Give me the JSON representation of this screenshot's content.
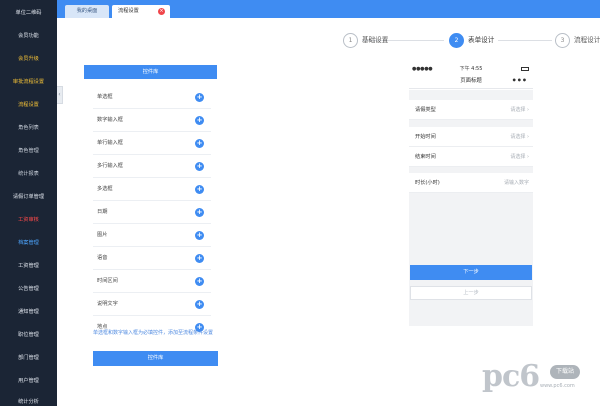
{
  "sidebar": {
    "items": [
      {
        "label": "单位二维码",
        "style": "normal"
      },
      {
        "label": "会员功能",
        "style": "normal"
      },
      {
        "label": "会员升级",
        "style": "yellow"
      },
      {
        "label": "审批流程设置",
        "style": "yellow"
      },
      {
        "label": "流程设置",
        "style": "yellow"
      },
      {
        "label": "角色列表",
        "style": "sub"
      },
      {
        "label": "角色管理",
        "style": "sub"
      },
      {
        "label": "统计报表",
        "style": "sub"
      },
      {
        "label": "请假订单管理",
        "style": "normal"
      },
      {
        "label": "工资审核",
        "style": "red"
      },
      {
        "label": "档案管理",
        "style": "blue"
      },
      {
        "label": "工资管理",
        "style": "normal"
      },
      {
        "label": "公告管理",
        "style": "normal"
      },
      {
        "label": "通知管理",
        "style": "normal"
      },
      {
        "label": "职位管理",
        "style": "normal"
      },
      {
        "label": "部门管理",
        "style": "normal"
      },
      {
        "label": "用户管理",
        "style": "normal"
      },
      {
        "label": "统计分析",
        "style": "normal"
      }
    ],
    "collapse_glyph": "‹"
  },
  "tabs": {
    "home": "我的桌面",
    "active": "流程设置",
    "close_glyph": "×"
  },
  "steps": [
    {
      "num": "1",
      "label": "基础设置",
      "active": false
    },
    {
      "num": "2",
      "label": "表单设计",
      "active": true
    },
    {
      "num": "3",
      "label": "流程设计",
      "active": false
    }
  ],
  "fields_panel": {
    "header": "控件库",
    "fields": [
      "单选框",
      "数字输入框",
      "单行输入框",
      "多行输入框",
      "多选框",
      "日期",
      "图片",
      "语音",
      "时间区间",
      "说明文字",
      "地点"
    ],
    "add_glyph": "+",
    "hint": "单选框和数字输入框为必填控件，添加至流程条件设置",
    "footer": "控件库"
  },
  "phone": {
    "signal": "●●●●●",
    "time": "下午 4:55",
    "title": "页面标题",
    "more": "•••",
    "rows": [
      {
        "label": "请假类型",
        "value": "请选择 ›"
      },
      {
        "label": "开始时间",
        "value": "请选择 ›"
      },
      {
        "label": "结束时间",
        "value": "请选择 ›"
      },
      {
        "label": "时长(小时)",
        "value": "请输入数字"
      }
    ],
    "next_button": "下一步",
    "prev_button": "上一步"
  },
  "watermark": {
    "text": "pc6",
    "badge": "下载站",
    "url": "www.pc6.com"
  },
  "colors": {
    "accent": "#3f8cf2",
    "sidebar_bg": "#1b2535",
    "close": "#f0454a"
  }
}
